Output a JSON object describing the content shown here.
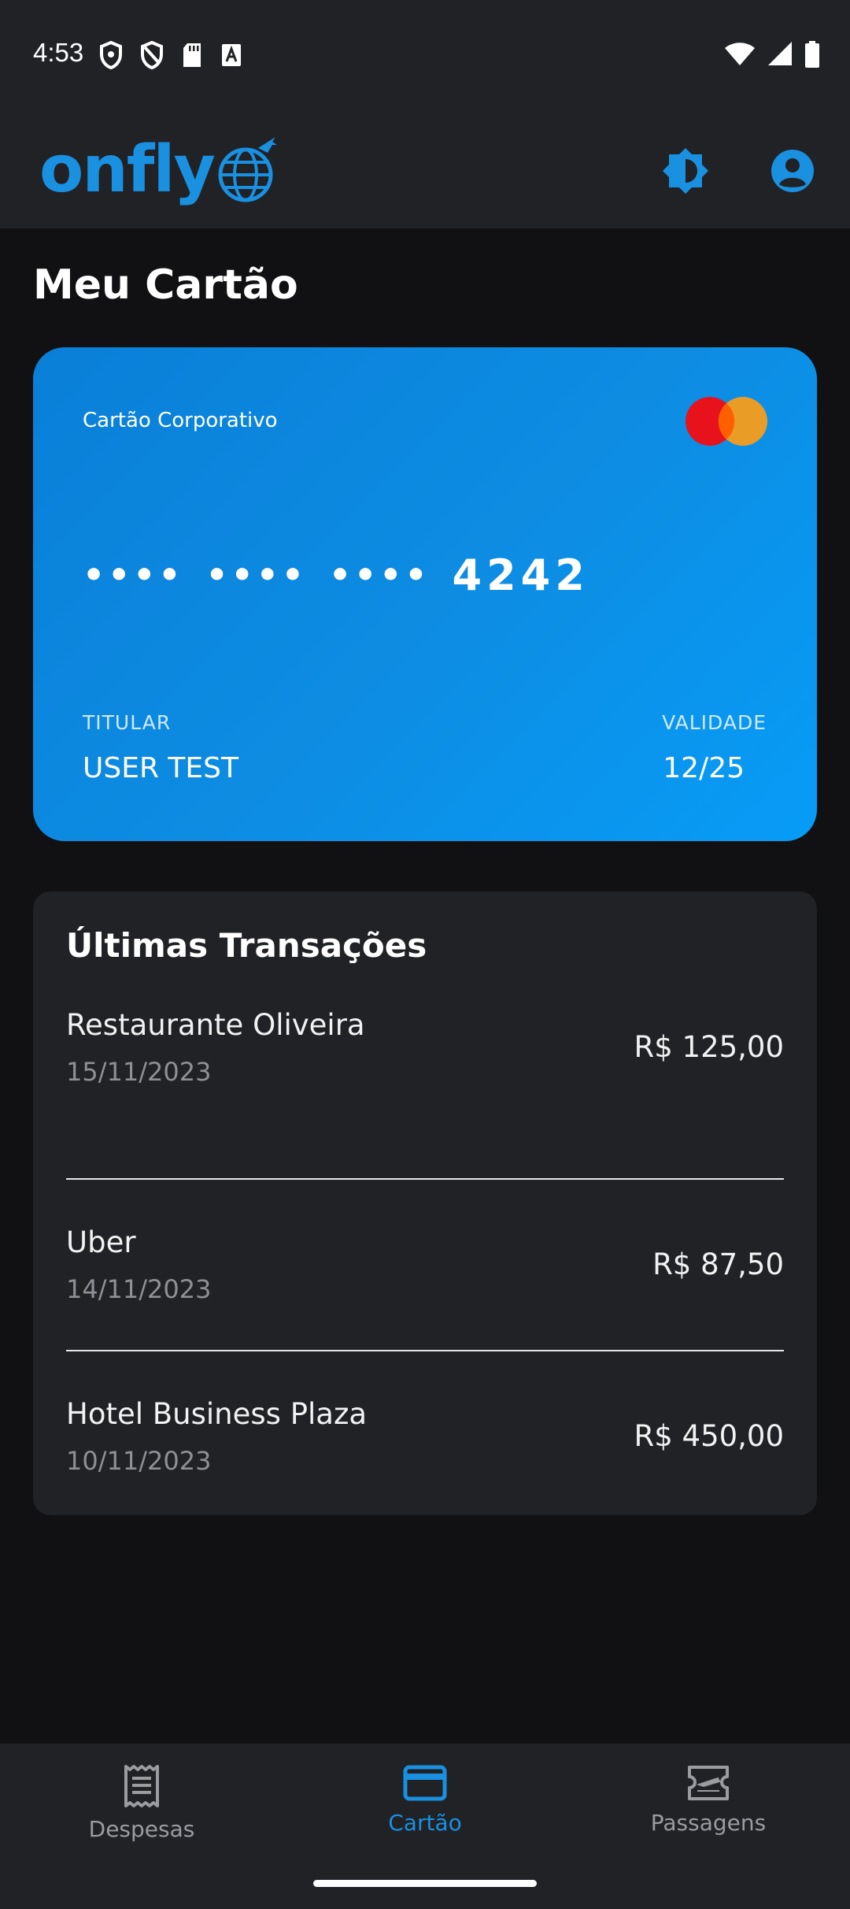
{
  "status_bar": {
    "time": "4:53",
    "left_icons": [
      "shield-icon",
      "shield-off-icon",
      "sd-card-icon",
      "font-icon"
    ],
    "right_icons": [
      "wifi-icon",
      "signal-icon",
      "battery-icon"
    ]
  },
  "header": {
    "logo_text": "onfly",
    "logo_icon": "globe-plane-icon",
    "theme_icon": "brightness-icon",
    "account_icon": "account-circle-icon",
    "accent_color": "#1a90e0"
  },
  "page": {
    "title": "Meu Cartão"
  },
  "card": {
    "label": "Cartão Corporativo",
    "brand_icon": "mastercard-logo",
    "masked_groups": [
      "••••",
      "••••",
      "••••"
    ],
    "last4": "4242",
    "holder_label": "TITULAR",
    "holder_name": "USER TEST",
    "validity_label": "VALIDADE",
    "validity": "12/25"
  },
  "transactions": {
    "title": "Últimas Transações",
    "items": [
      {
        "name": "Restaurante Oliveira",
        "date": "15/11/2023",
        "amount": "R$ 125,00"
      },
      {
        "name": "Uber",
        "date": "14/11/2023",
        "amount": "R$ 87,50"
      },
      {
        "name": "Hotel Business Plaza",
        "date": "10/11/2023",
        "amount": "R$ 450,00"
      }
    ]
  },
  "bottom_nav": {
    "items": [
      {
        "label": "Despesas",
        "icon": "receipt-icon",
        "active": false
      },
      {
        "label": "Cartão",
        "icon": "credit-card-icon",
        "active": true
      },
      {
        "label": "Passagens",
        "icon": "flight-ticket-icon",
        "active": false
      }
    ]
  }
}
